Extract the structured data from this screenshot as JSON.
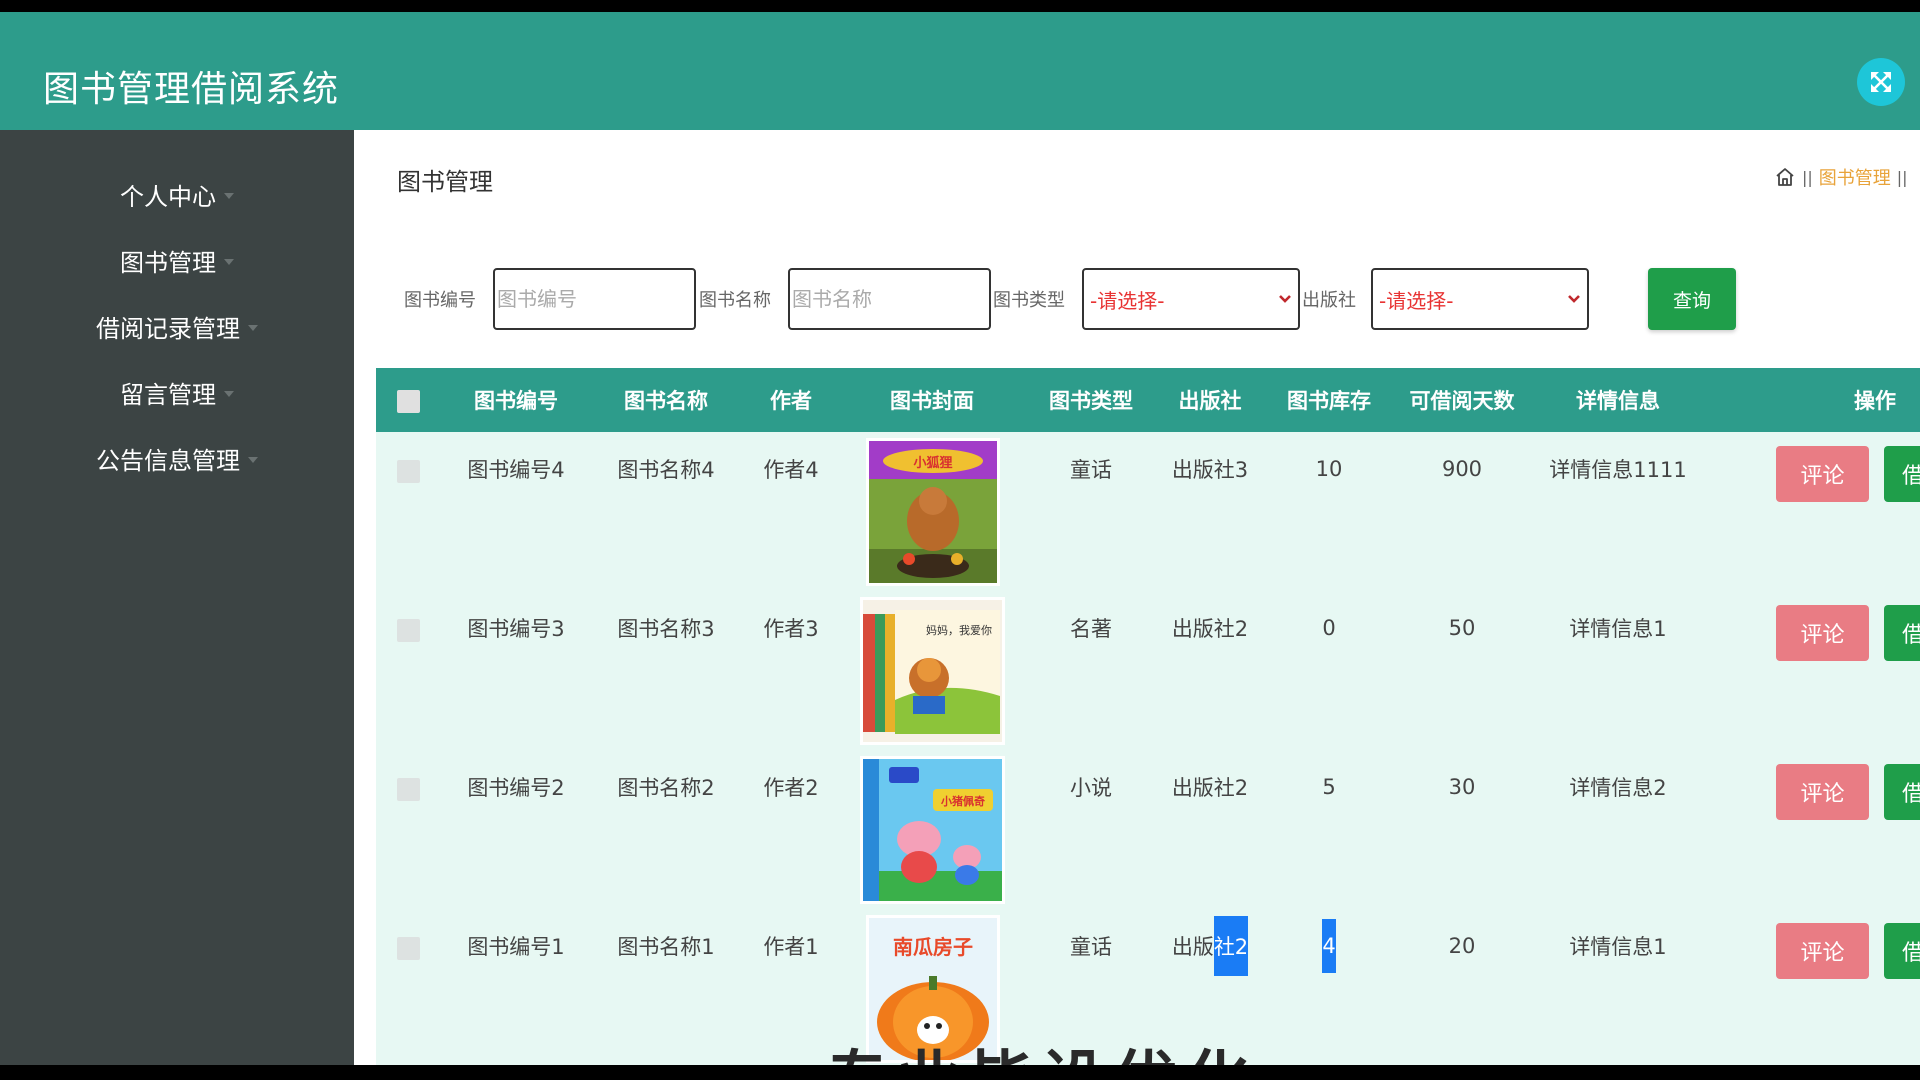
{
  "app": {
    "title": "图书管理借阅系统"
  },
  "colors": {
    "header": "#2d9c8b",
    "sidebar": "#3c4444",
    "accent": "#1f9e4a",
    "comment": "#e97c84",
    "crumb": "#e8a33a",
    "fullscreen": "#1ec6d8"
  },
  "icons": {
    "fullscreen": "arrows-expand-icon",
    "home": "home-icon",
    "nav_caret": "caret-down-icon",
    "select_caret": "chevron-down-icon"
  },
  "sidebar": {
    "items": [
      {
        "label": "个人中心"
      },
      {
        "label": "图书管理"
      },
      {
        "label": "借阅记录管理"
      },
      {
        "label": "留言管理"
      },
      {
        "label": "公告信息管理"
      }
    ]
  },
  "main": {
    "title": "图书管理",
    "breadcrumb": {
      "sep": "||",
      "current": "图书管理"
    }
  },
  "search": {
    "book_no_label": "图书编号",
    "book_no_placeholder": "图书编号",
    "book_name_label": "图书名称",
    "book_name_placeholder": "图书名称",
    "book_type_label": "图书类型",
    "book_type_value": "-请选择-",
    "publisher_label": "出版社",
    "publisher_value": "-请选择-",
    "query_label": "查询"
  },
  "table": {
    "headers": [
      "图书编号",
      "图书名称",
      "作者",
      "图书封面",
      "图书类型",
      "出版社",
      "图书库存",
      "可借阅天数",
      "详情信息",
      "操作"
    ],
    "rows": [
      {
        "book_no": "图书编号4",
        "book_name": "图书名称4",
        "author": "作者4",
        "type": "童话",
        "publisher": "出版社3",
        "stock": "10",
        "days": "900",
        "detail": "详情信息1111"
      },
      {
        "book_no": "图书编号3",
        "book_name": "图书名称3",
        "author": "作者3",
        "type": "名著",
        "publisher": "出版社2",
        "stock": "0",
        "days": "50",
        "detail": "详情信息1"
      },
      {
        "book_no": "图书编号2",
        "book_name": "图书名称2",
        "author": "作者2",
        "type": "小说",
        "publisher": "出版社2",
        "stock": "5",
        "days": "30",
        "detail": "详情信息2"
      },
      {
        "book_no": "图书编号1",
        "book_name": "图书名称1",
        "author": "作者1",
        "type": "童话",
        "publisher_prefix": "出版",
        "publisher_highlight": "社2",
        "stock": "4",
        "days": "20",
        "detail": "详情信息1"
      }
    ],
    "comment_label": "评论",
    "borrow_label": "借"
  },
  "covers": [
    "小狐狸",
    "妈妈，我爱你",
    "小猪佩奇",
    "南瓜房子"
  ],
  "watermark": "专业毕设优化"
}
